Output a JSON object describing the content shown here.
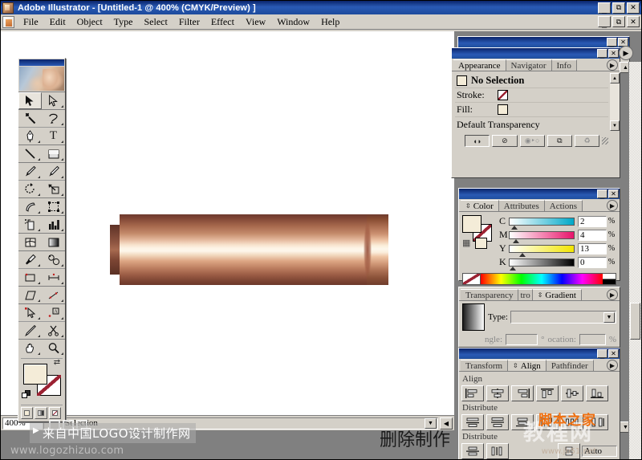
{
  "window": {
    "title": "Adobe Illustrator - [Untitled-1 @ 400% (CMYK/Preview) ]",
    "app_icon": "illustrator-icon",
    "minimize": "_",
    "restore": "❐",
    "close": "✕"
  },
  "menubar": {
    "doc_icon": "document-icon",
    "items": [
      {
        "label": "File"
      },
      {
        "label": "Edit"
      },
      {
        "label": "Object"
      },
      {
        "label": "Type"
      },
      {
        "label": "Select"
      },
      {
        "label": "Filter"
      },
      {
        "label": "Effect"
      },
      {
        "label": "View"
      },
      {
        "label": "Window"
      },
      {
        "label": "Help"
      }
    ]
  },
  "toolbox": {
    "tools": [
      {
        "name": "selection-tool",
        "glyph": "➤",
        "active": true
      },
      {
        "name": "direct-selection-tool",
        "glyph": "➤",
        "active": false
      },
      {
        "name": "magic-wand-tool",
        "glyph": "✳",
        "active": false
      },
      {
        "name": "lasso-tool",
        "glyph": "❦",
        "active": false
      },
      {
        "name": "pen-tool",
        "glyph": "✐",
        "active": false
      },
      {
        "name": "type-tool",
        "glyph": "T",
        "active": false
      },
      {
        "name": "line-segment-tool",
        "glyph": "╲",
        "active": false
      },
      {
        "name": "rectangle-tool",
        "glyph": "■",
        "active": false
      },
      {
        "name": "paintbrush-tool",
        "glyph": "✎",
        "active": false
      },
      {
        "name": "pencil-tool",
        "glyph": "✏",
        "active": false
      },
      {
        "name": "rotate-tool",
        "glyph": "↻",
        "active": false
      },
      {
        "name": "scale-tool",
        "glyph": "⤡",
        "active": false
      },
      {
        "name": "warp-tool",
        "glyph": "☞",
        "active": false
      },
      {
        "name": "free-transform-tool",
        "glyph": "⬚",
        "active": false
      },
      {
        "name": "symbol-sprayer-tool",
        "glyph": "⚒",
        "active": false
      },
      {
        "name": "column-graph-tool",
        "glyph": "█",
        "active": false
      },
      {
        "name": "mesh-tool",
        "glyph": "⊞",
        "active": false
      },
      {
        "name": "gradient-tool",
        "glyph": "▤",
        "active": false
      },
      {
        "name": "eyedropper-tool",
        "glyph": "⚗",
        "active": false
      },
      {
        "name": "blend-tool",
        "glyph": "⚬",
        "active": false
      },
      {
        "name": "slice-tool",
        "glyph": "⌸",
        "active": false
      },
      {
        "name": "measure-tool",
        "glyph": "↔",
        "active": false
      },
      {
        "name": "page-tool",
        "glyph": "◱",
        "active": false
      },
      {
        "name": "knife-tool",
        "glyph": "╱",
        "active": false
      },
      {
        "name": "hand-move-tool",
        "glyph": "↖",
        "active": false
      },
      {
        "name": "anchor-point-tool",
        "glyph": "Ⓐ",
        "active": false
      },
      {
        "name": "scissors-tool",
        "glyph": "✂",
        "active": false
      },
      {
        "name": "erase-tool",
        "glyph": "✄",
        "active": false
      },
      {
        "name": "hand-tool",
        "glyph": "✋",
        "active": false
      },
      {
        "name": "zoom-tool",
        "glyph": "⚲",
        "active": false
      }
    ],
    "fill_stroke": {
      "fill_label": "fill-swatch",
      "fill_color": "#f4ecd8",
      "stroke_label": "stroke-swatch",
      "stroke_color": "none",
      "swap_glyph": "⇄"
    },
    "modes": [
      {
        "name": "color-mode-button"
      },
      {
        "name": "gradient-mode-button"
      },
      {
        "name": "none-mode-button"
      }
    ]
  },
  "document": {
    "artwork_name": "metallic-copper-cylinder",
    "canvas_text": "删除制作"
  },
  "appearance_panel": {
    "tabs": [
      {
        "label": "Appearance",
        "active": true
      },
      {
        "label": "Navigator",
        "active": false
      },
      {
        "label": "Info",
        "active": false
      }
    ],
    "header": "No Selection",
    "rows": [
      {
        "label": "Stroke:",
        "swatch": "none"
      },
      {
        "label": "Fill:",
        "swatch": "fill"
      }
    ],
    "footer_label": "Default Transparency",
    "buttons": [
      {
        "name": "new-art-has-basic-appearance-button",
        "glyph": "◐◑"
      },
      {
        "name": "clear-appearance-button",
        "glyph": "⊘"
      },
      {
        "name": "reduce-to-basic-appearance-button",
        "glyph": "●▸○"
      },
      {
        "name": "duplicate-item-button",
        "glyph": "⧉"
      },
      {
        "name": "delete-item-button",
        "glyph": "♻"
      }
    ]
  },
  "color_panel": {
    "tabs": [
      {
        "label": "Color",
        "active": true
      },
      {
        "label": "Attributes",
        "active": false
      },
      {
        "label": "Actions",
        "active": false
      }
    ],
    "channels": [
      {
        "label": "C",
        "value": "2",
        "unit": "%"
      },
      {
        "label": "M",
        "value": "4",
        "unit": "%"
      },
      {
        "label": "Y",
        "value": "13",
        "unit": "%"
      },
      {
        "label": "K",
        "value": "0",
        "unit": "%"
      }
    ],
    "fill_color": "#f4ecd8",
    "stroke_color": "none"
  },
  "gradient_panel": {
    "tabs": [
      {
        "label": "Transparency",
        "active": false
      },
      {
        "label": "tro",
        "active": false
      },
      {
        "label": "Gradient",
        "active": true
      }
    ],
    "type_label": "Type:",
    "type_value": "",
    "angle_label": "ngle:",
    "angle_value": "",
    "angle_unit": "°",
    "location_label": "ocation:",
    "location_value": "",
    "location_unit": "%"
  },
  "align_panel": {
    "tabs": [
      {
        "label": "Transform",
        "active": false
      },
      {
        "label": "Align",
        "active": true
      },
      {
        "label": "Pathfinder",
        "active": false
      }
    ],
    "sections": [
      {
        "title": "Align",
        "buttons": [
          {
            "name": "align-left-button"
          },
          {
            "name": "align-horizontal-center-button"
          },
          {
            "name": "align-right-button"
          },
          {
            "name": "align-top-button"
          },
          {
            "name": "align-vertical-center-button"
          },
          {
            "name": "align-bottom-button"
          }
        ]
      },
      {
        "title": "Distribute",
        "buttons": [
          {
            "name": "distribute-top-button"
          },
          {
            "name": "distribute-vertical-center-button"
          },
          {
            "name": "distribute-bottom-button"
          },
          {
            "name": "distribute-left-button"
          },
          {
            "name": "distribute-horizontal-center-button"
          },
          {
            "name": "distribute-right-button"
          }
        ]
      },
      {
        "title": "Distribute",
        "buttons": [
          {
            "name": "distribute-vertical-spacing-button"
          },
          {
            "name": "distribute-horizontal-spacing-button"
          }
        ]
      }
    ],
    "auto_label": "Auto"
  },
  "statusbar": {
    "zoom": "400%",
    "status": "Selection",
    "dropdown_glyph": "▼",
    "prev_glyph": "◀"
  },
  "watermarks": {
    "banner": "来自中国LOGO设计制作网",
    "url": "www.logozhizuo.com",
    "brand_orange": "脚本之家",
    "brand_gray": "教程网",
    "small_url": "www.jb51.net"
  }
}
